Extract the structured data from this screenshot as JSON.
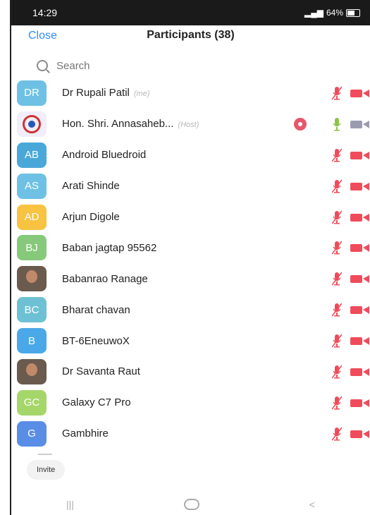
{
  "status_bar": {
    "time": "14:29",
    "battery": "64%"
  },
  "header": {
    "close_label": "Close",
    "title": "Participants (38)"
  },
  "search": {
    "placeholder": "Search"
  },
  "participants": [
    {
      "initials": "DR",
      "name": "Dr Rupali Patil",
      "tag": "(me)",
      "avatar_color": "#6ec1e4",
      "avatar_type": "initials",
      "mic": "muted",
      "video": "off"
    },
    {
      "initials": "",
      "name": "Hon. Shri. Annasaheb...",
      "tag": "(Host)",
      "avatar_color": "#f0eef8",
      "avatar_type": "logo",
      "mic": "on",
      "video": "off-gray",
      "recording": true
    },
    {
      "initials": "AB",
      "name": "Android Bluedroid",
      "tag": "",
      "avatar_color": "#4aa8d8",
      "avatar_type": "initials",
      "mic": "muted",
      "video": "off"
    },
    {
      "initials": "AS",
      "name": "Arati Shinde",
      "tag": "",
      "avatar_color": "#6ec1e4",
      "avatar_type": "initials",
      "mic": "muted",
      "video": "off"
    },
    {
      "initials": "AD",
      "name": "Arjun Digole",
      "tag": "",
      "avatar_color": "#f7c341",
      "avatar_type": "initials",
      "mic": "muted",
      "video": "off"
    },
    {
      "initials": "BJ",
      "name": "Baban jagtap 95562",
      "tag": "",
      "avatar_color": "#86c97a",
      "avatar_type": "initials",
      "mic": "muted",
      "video": "off"
    },
    {
      "initials": "",
      "name": "Babanrao Ranage",
      "tag": "",
      "avatar_color": "#6b5a4e",
      "avatar_type": "photo",
      "mic": "muted",
      "video": "off"
    },
    {
      "initials": "BC",
      "name": "Bharat chavan",
      "tag": "",
      "avatar_color": "#6ec1d4",
      "avatar_type": "initials",
      "mic": "muted",
      "video": "off"
    },
    {
      "initials": "B",
      "name": "BT-6EneuwoX",
      "tag": "",
      "avatar_color": "#4aa8e8",
      "avatar_type": "initials",
      "mic": "muted",
      "video": "off"
    },
    {
      "initials": "",
      "name": "Dr Savanta Raut",
      "tag": "",
      "avatar_color": "#6b5a4e",
      "avatar_type": "photo",
      "mic": "muted",
      "video": "off"
    },
    {
      "initials": "GC",
      "name": "Galaxy C7 Pro",
      "tag": "",
      "avatar_color": "#a5d66a",
      "avatar_type": "initials",
      "mic": "muted",
      "video": "off"
    },
    {
      "initials": "G",
      "name": "Gambhire",
      "tag": "",
      "avatar_color": "#5a8ee6",
      "avatar_type": "initials",
      "mic": "muted",
      "video": "off"
    }
  ],
  "footer": {
    "invite_label": "Invite"
  },
  "nav": {
    "recents": "|||",
    "back": "<"
  },
  "colors": {
    "accent": "#2d8cff",
    "muted": "#f04b5a"
  }
}
